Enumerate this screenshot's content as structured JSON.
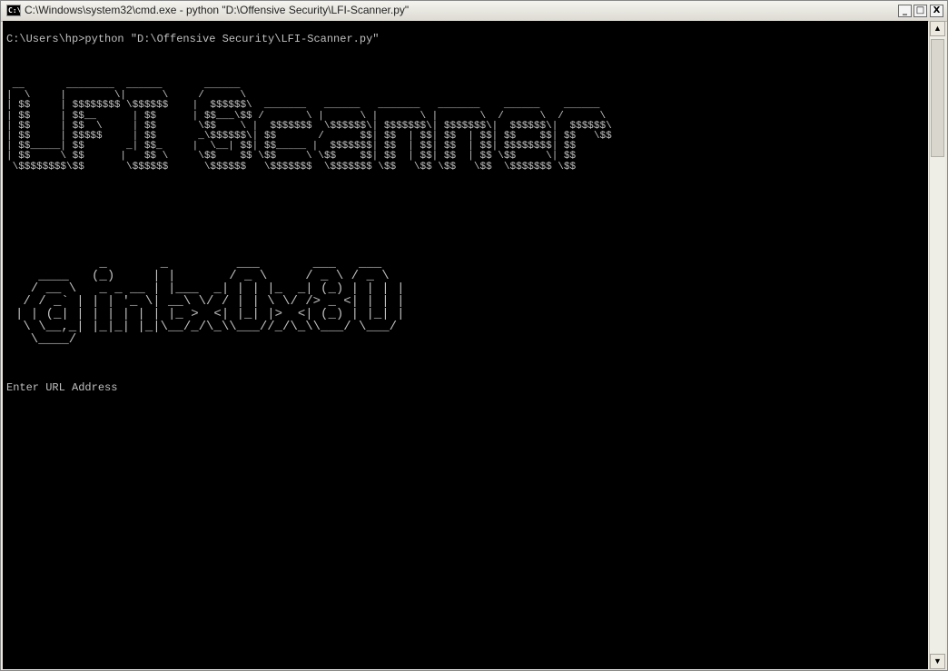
{
  "window": {
    "title": "C:\\Windows\\system32\\cmd.exe - python  \"D:\\Offensive Security\\LFI-Scanner.py\"",
    "icon_text": "C:\\",
    "buttons": {
      "minimize": "_",
      "maximize": "□",
      "close": "X"
    }
  },
  "console": {
    "command_line": "C:\\Users\\hp>python \"D:\\Offensive Security\\LFI-Scanner.py\"",
    "banner_lfi": " __       ________  ______       ______\n|  \\     |        \\|      \\     /      \\\n| $$     | $$$$$$$$ \\$$$$$$    |  $$$$$$\\  _______   ______   _______   _______    ______    ______\n| $$     | $$__      | $$      | $$___\\$$ /       \\ |      \\ |       \\ |       \\  /      \\  /      \\\n| $$     | $$  \\     | $$       \\$$    \\ |  $$$$$$$  \\$$$$$$\\| $$$$$$$\\| $$$$$$$\\|  $$$$$$\\|  $$$$$$\\\n| $$     | $$$$$     | $$       _\\$$$$$$\\| $$       /      $$| $$  | $$| $$  | $$| $$    $$| $$   \\$$\n| $$_____| $$       _| $$_     |  \\__| $$| $$_____ |  $$$$$$$| $$  | $$| $$  | $$| $$$$$$$$| $$\n| $$     \\ $$      |   $$ \\     \\$$    $$ \\$$     \\ \\$$    $$| $$  | $$| $$  | $$ \\$$     \\| $$\n \\$$$$$$$$\\$$       \\$$$$$$      \\$$$$$$   \\$$$$$$$  \\$$$$$$$ \\$$   \\$$ \\$$   \\$$  \\$$$$$$$ \\$$",
    "banner_handle": "           _       _         ___       ___   ___\n   ____   (_)     | |       / _ \\     / _ \\ / _ \\\n  / __ \\   _ _ __ | |___  _| | | |_  _| (_) | | | |\n / / _` | | | '_ \\| __\\ \\/ / | | \\ \\/ /> _ <| | | |\n| | (_| | | | | | | |_ >  <| |_| |>  <| (_) | |_| |\n \\ \\__,_| |_|_| |_|\\__/_/\\_\\\\___//_/\\_\\\\___/ \\___/\n  \\____/",
    "prompt": "Enter URL Address"
  },
  "scrollbar": {
    "up_arrow": "▲",
    "down_arrow": "▼"
  }
}
